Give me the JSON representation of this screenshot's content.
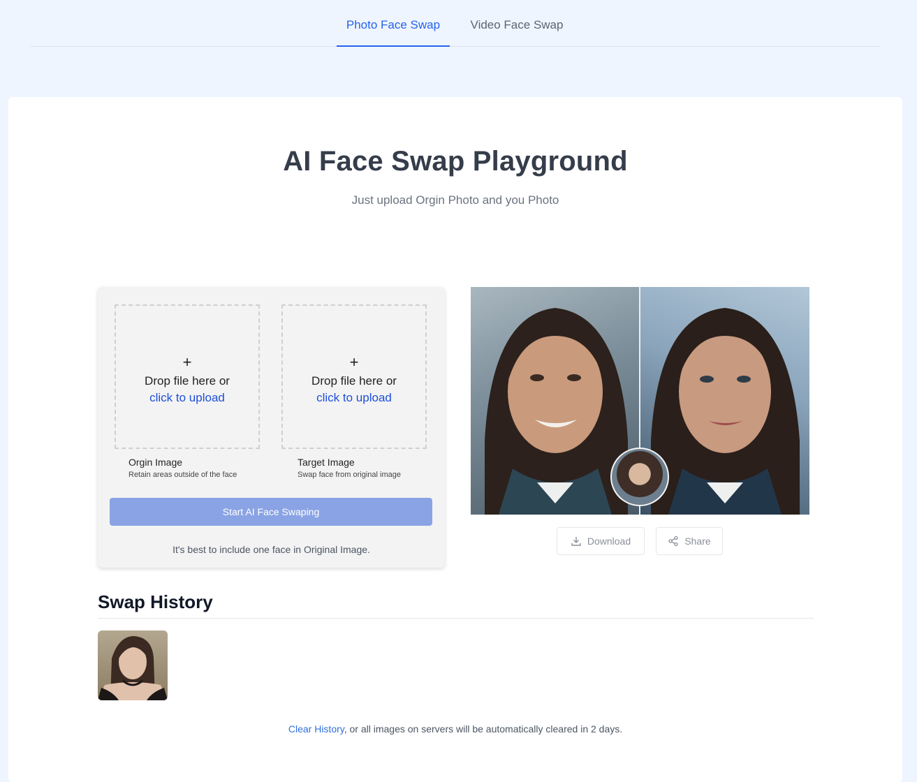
{
  "tabs": [
    {
      "label": "Photo Face Swap",
      "active": true
    },
    {
      "label": "Video Face Swap",
      "active": false
    }
  ],
  "header": {
    "title": "AI Face Swap Playground",
    "subtitle": "Just upload Orgin Photo and you Photo"
  },
  "upload": {
    "plus": "+",
    "drop_text": "Drop file here or",
    "click_text": "click to upload",
    "origin": {
      "label": "Orgin Image",
      "hint": "Retain areas outside of the face"
    },
    "target": {
      "label": "Target Image",
      "hint": "Swap face from original image"
    },
    "start_button": "Start AI Face Swaping",
    "note": "It's best to include one face in Original Image."
  },
  "preview": {
    "download_label": "Download",
    "share_label": "Share"
  },
  "history": {
    "title": "Swap History",
    "clear_link": "Clear History",
    "clear_suffix": ", or all images on servers will be automatically cleared in 2 days."
  },
  "colors": {
    "accent": "#2563eb",
    "start_button": "#8aa3e4",
    "page_bg": "#eff5fe"
  }
}
